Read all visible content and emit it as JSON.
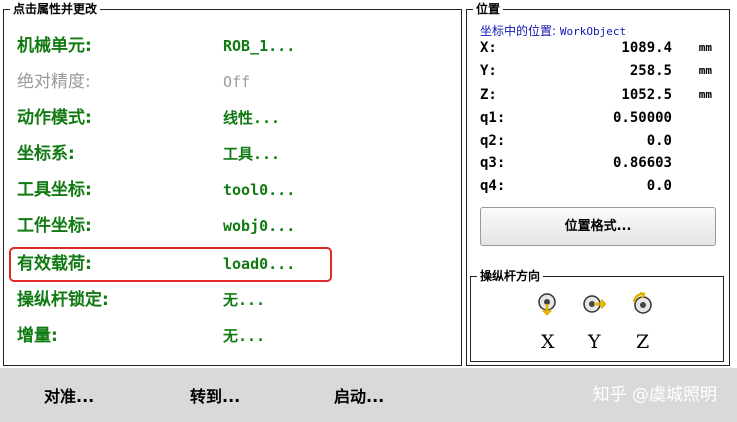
{
  "left_panel": {
    "title": "点击属性并更改",
    "rows": [
      {
        "label": "机械单元:",
        "value": "ROB_1..."
      },
      {
        "label": "绝对精度:",
        "value": "Off"
      },
      {
        "label": "动作模式:",
        "value": "线性..."
      },
      {
        "label": "坐标系:",
        "value": "工具..."
      },
      {
        "label": "工具坐标:",
        "value": "tool0..."
      },
      {
        "label": "工件坐标:",
        "value": "wobj0..."
      },
      {
        "label": "有效载荷:",
        "value": "load0..."
      },
      {
        "label": "操纵杆锁定:",
        "value": "无..."
      },
      {
        "label": "增量:",
        "value": "无..."
      }
    ],
    "highlighted_row": "有效载荷:"
  },
  "position_panel": {
    "title": "位置",
    "caption_prefix": "坐标中的位置:",
    "caption_ref": "WorkObject",
    "rows": [
      {
        "key": "X:",
        "value": "1089.4",
        "unit": "mm"
      },
      {
        "key": "Y:",
        "value": "258.5",
        "unit": "mm"
      },
      {
        "key": "Z:",
        "value": "1052.5",
        "unit": "mm"
      },
      {
        "key": "q1:",
        "value": "0.50000",
        "unit": ""
      },
      {
        "key": "q2:",
        "value": "0.0",
        "unit": ""
      },
      {
        "key": "q3:",
        "value": "0.86603",
        "unit": ""
      },
      {
        "key": "q4:",
        "value": "0.0",
        "unit": ""
      }
    ],
    "format_button": "位置格式..."
  },
  "joystick_panel": {
    "title": "操纵杆方向",
    "axes": [
      {
        "label": "X",
        "icon": "joystick-x-icon"
      },
      {
        "label": "Y",
        "icon": "joystick-y-icon"
      },
      {
        "label": "Z",
        "icon": "joystick-z-icon"
      }
    ]
  },
  "bottom_bar": {
    "buttons": [
      "对准...",
      "转到...",
      "启动..."
    ],
    "watermark": "知乎 @虞城照明"
  },
  "colors": {
    "label_green": "#127a12",
    "disabled_gray": "#9a9a9a",
    "highlight_red": "#e02a2a",
    "caption_blue": "#1515b4",
    "bar_gray": "#d9d9d9"
  }
}
